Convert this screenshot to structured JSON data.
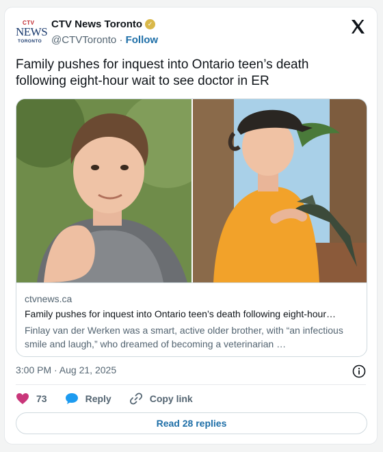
{
  "account": {
    "logo_lines": [
      "CTV",
      "NEWS",
      "TORONTO"
    ],
    "display_name": "CTV News Toronto",
    "handle": "@CTVToronto",
    "separator": "·",
    "follow_label": "Follow",
    "verified_badge_icon": "verified-gold-badge-icon",
    "brand_color": "#1a3a6e"
  },
  "platform_icon": "x-logo-icon",
  "tweet": {
    "text": "Family pushes for inquest into Ontario teen’s death following eight-hour wait to see doctor in ER"
  },
  "link_card": {
    "images": [
      "young man in grey puffer vest outdoors",
      "boy in orange shirt holding small alligator"
    ],
    "domain": "ctvnews.ca",
    "title": "Family pushes for inquest into Ontario teen’s death following eight-hour…",
    "description": "Finlay van der Werken was a smart, active older brother, with “an infectious smile and laugh,” who dreamed of becoming a veterinarian …"
  },
  "meta": {
    "timestamp": "3:00 PM · Aug 21, 2025",
    "info_icon": "info-icon"
  },
  "actions": {
    "like_count": "73",
    "like_icon": "heart-icon",
    "reply_label": "Reply",
    "reply_icon": "speech-bubble-icon",
    "copy_label": "Copy link",
    "copy_icon": "link-icon",
    "like_color": "#c9367a",
    "reply_color": "#1d9bf0"
  },
  "read_replies_label": "Read 28 replies"
}
